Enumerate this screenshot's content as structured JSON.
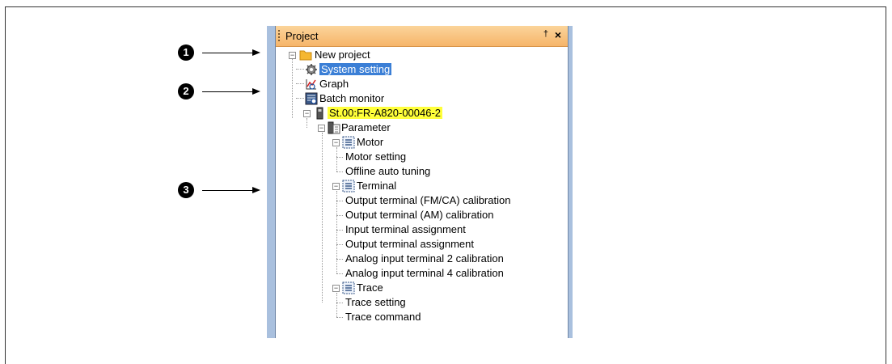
{
  "callouts": [
    "1",
    "2",
    "3"
  ],
  "panel": {
    "title": "Project",
    "pin_icon": "pin-icon",
    "close_icon": "close-icon",
    "pin_label": "†",
    "close_label": "×"
  },
  "tree": {
    "root": "New project",
    "system_setting": "System setting",
    "graph": "Graph",
    "batch_monitor": "Batch monitor",
    "station": "St.00:FR-A820-00046-2",
    "parameter": "Parameter",
    "motor": {
      "label": "Motor",
      "items": [
        "Motor setting",
        "Offline auto tuning"
      ]
    },
    "terminal": {
      "label": "Terminal",
      "items": [
        "Output terminal (FM/CA) calibration",
        "Output terminal (AM) calibration",
        "Input terminal assignment",
        "Output terminal assignment",
        "Analog input terminal 2 calibration",
        "Analog input terminal 4 calibration"
      ]
    },
    "trace": {
      "label": "Trace",
      "items": [
        "Trace setting",
        "Trace command"
      ]
    },
    "toggle_symbol": "−"
  },
  "colors": {
    "title_bar": "#f6b56a",
    "selection": "#3b7fd6",
    "station_highlight": "#ffff3a",
    "panel_border": "#a9c0de"
  }
}
